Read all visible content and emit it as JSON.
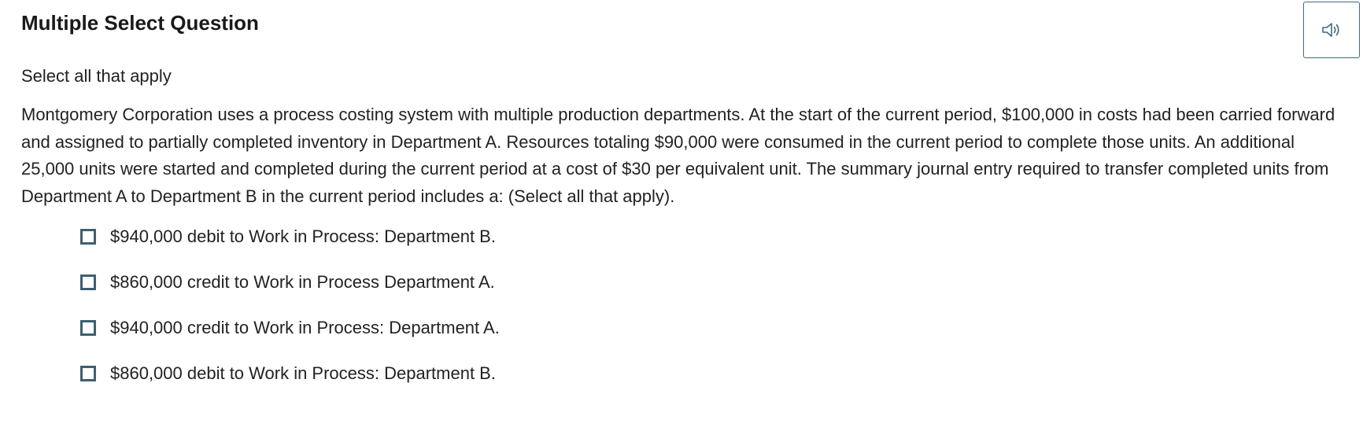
{
  "question": {
    "title": "Multiple Select Question",
    "instruction": "Select all that apply",
    "prompt": "Montgomery Corporation uses a process costing system with multiple production departments. At the start of the current period, $100,000 in costs had been carried forward and assigned to partially completed inventory in Department A. Resources totaling $90,000 were consumed in the current period to complete those units. An additional 25,000 units were started and completed during the current period at a cost of $30 per equivalent unit. The summary journal entry required to transfer completed units from Department A to Department B in the current period includes a: (Select all that apply).",
    "options": [
      {
        "label": "$940,000 debit to Work in Process: Department B.",
        "checked": false
      },
      {
        "label": "$860,000 credit to Work in Process Department A.",
        "checked": false
      },
      {
        "label": "$940,000 credit to Work in Process: Department A.",
        "checked": false
      },
      {
        "label": "$860,000 debit to Work in Process: Department B.",
        "checked": false
      }
    ]
  },
  "toolbar": {
    "audio_icon": "speaker-icon"
  },
  "colors": {
    "accent": "#3f5f70",
    "text": "#222222"
  }
}
